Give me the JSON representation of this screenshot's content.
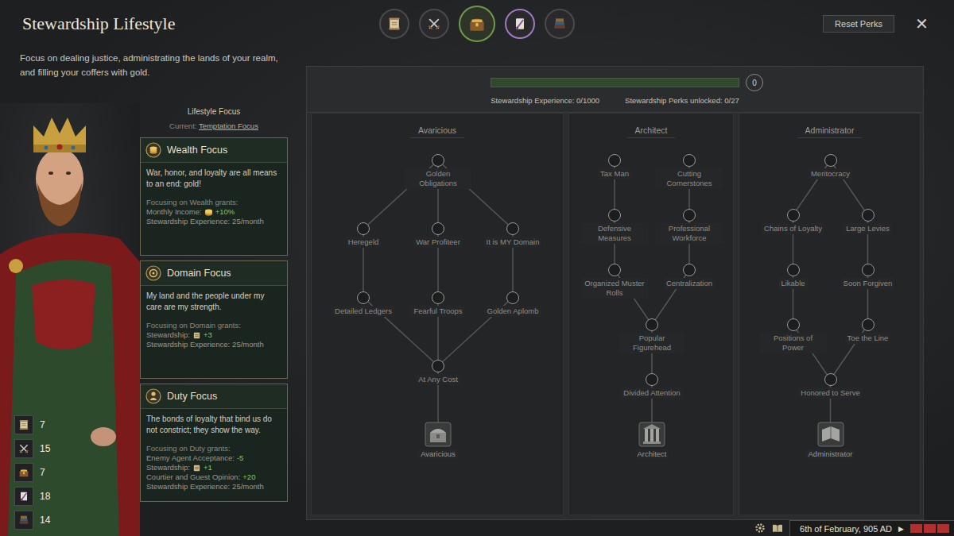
{
  "window": {
    "title": "Stewardship Lifestyle",
    "description": "Focus on dealing justice, administrating the lands of your realm, and filling your coffers with gold.",
    "reset_button": "Reset Perks",
    "close_icon": "✕"
  },
  "lifestyle_tabs": [
    {
      "kind": "diplomacy",
      "selected": false,
      "hovered": false
    },
    {
      "kind": "martial",
      "selected": false,
      "hovered": false
    },
    {
      "kind": "stewardship",
      "selected": true,
      "hovered": false
    },
    {
      "kind": "intrigue",
      "selected": false,
      "hovered": true
    },
    {
      "kind": "learning",
      "selected": false,
      "hovered": false
    }
  ],
  "skills": [
    {
      "kind": "diplomacy",
      "value": "7"
    },
    {
      "kind": "martial",
      "value": "15"
    },
    {
      "kind": "stewardship",
      "value": "7"
    },
    {
      "kind": "intrigue",
      "value": "18"
    },
    {
      "kind": "learning",
      "value": "14"
    }
  ],
  "focus": {
    "header": "Lifestyle Focus",
    "current_label": "Current:",
    "current": "Temptation Focus",
    "cards": [
      {
        "kind": "wealth",
        "title": "Wealth Focus",
        "selected": false,
        "description": "War, honor, and loyalty are all means to an end: gold!",
        "grants_label": "Focusing on Wealth grants:",
        "grants": [
          {
            "label": "Monthly Income:",
            "kind": "coin",
            "value": "+10%",
            "good": true
          },
          {
            "label": "Stewardship Experience:",
            "kind": "none",
            "value": "25/month",
            "good": false
          }
        ]
      },
      {
        "kind": "domain",
        "title": "Domain Focus",
        "selected": false,
        "description": "My land and the people under my care are my strength.",
        "grants_label": "Focusing on Domain grants:",
        "grants": [
          {
            "label": "Stewardship:",
            "kind": "stewardship",
            "value": "+3",
            "good": true
          },
          {
            "label": "Stewardship Experience:",
            "kind": "none",
            "value": "25/month",
            "good": false
          }
        ]
      },
      {
        "kind": "duty",
        "title": "Duty Focus",
        "selected": false,
        "description": "The bonds of loyalty that bind us do not constrict; they show the way.",
        "grants_label": "Focusing on Duty grants:",
        "grants": [
          {
            "label": "Enemy Agent Acceptance:",
            "kind": "none",
            "value": "-5",
            "good": true
          },
          {
            "label": "Stewardship:",
            "kind": "stewardship",
            "value": "+1",
            "good": true
          },
          {
            "label": "Courtier and Guest Opinion:",
            "kind": "none",
            "value": "+20",
            "good": true
          },
          {
            "label": "Stewardship Experience:",
            "kind": "none",
            "value": "25/month",
            "good": false
          }
        ]
      }
    ]
  },
  "progress": {
    "level": 0,
    "points": "0",
    "experience": "Stewardship Experience: 0/1000",
    "perks": "Stewardship Perks unlocked: 0/27"
  },
  "trees": [
    {
      "kind": "avaricious",
      "title": "Avaricious",
      "trait": "Avaricious",
      "tiers": [
        [
          {
            "label": "Golden Obligations",
            "unlocked": false
          }
        ],
        [
          {
            "label": "Heregeld",
            "unlocked": false
          },
          {
            "label": "War Profiteer",
            "unlocked": false
          },
          {
            "label": "It is MY Domain",
            "unlocked": false
          }
        ],
        [
          {
            "label": "Detailed Ledgers",
            "unlocked": false
          },
          {
            "label": "Fearful Troops",
            "unlocked": false
          },
          {
            "label": "Golden Aplomb",
            "unlocked": false
          }
        ],
        [
          {
            "label": "At Any Cost",
            "unlocked": false
          }
        ]
      ]
    },
    {
      "kind": "architect",
      "title": "Architect",
      "trait": "Architect",
      "tiers": [
        [
          {
            "label": "Tax Man",
            "unlocked": false
          },
          {
            "label": "Cutting Cornerstones",
            "unlocked": false
          }
        ],
        [
          {
            "label": "Defensive Measures",
            "unlocked": false
          },
          {
            "label": "Professional Workforce",
            "unlocked": false
          }
        ],
        [
          {
            "label": "Organized Muster Rolls",
            "unlocked": false
          },
          {
            "label": "Centralization",
            "unlocked": false
          }
        ],
        [
          {
            "label": "Popular Figurehead",
            "unlocked": false
          }
        ],
        [
          {
            "label": "Divided Attention",
            "unlocked": false
          }
        ]
      ]
    },
    {
      "kind": "administrator",
      "title": "Administrator",
      "trait": "Administrator",
      "tiers": [
        [
          {
            "label": "Meritocracy",
            "unlocked": false
          }
        ],
        [
          {
            "label": "Chains of Loyalty",
            "unlocked": false
          },
          {
            "label": "Large Levies",
            "unlocked": false
          }
        ],
        [
          {
            "label": "Likable",
            "unlocked": false
          },
          {
            "label": "Soon Forgiven",
            "unlocked": false
          }
        ],
        [
          {
            "label": "Positions of Power",
            "unlocked": false
          },
          {
            "label": "Toe the Line",
            "unlocked": false
          }
        ],
        [
          {
            "label": "Honored to Serve",
            "unlocked": false
          }
        ]
      ]
    }
  ],
  "status_bar": {
    "date": "6th of February, 905 AD",
    "play_icon": "▶",
    "paused": true,
    "speed_bars": [
      {
        "on": true
      },
      {
        "on": true
      },
      {
        "on": true
      }
    ]
  }
}
